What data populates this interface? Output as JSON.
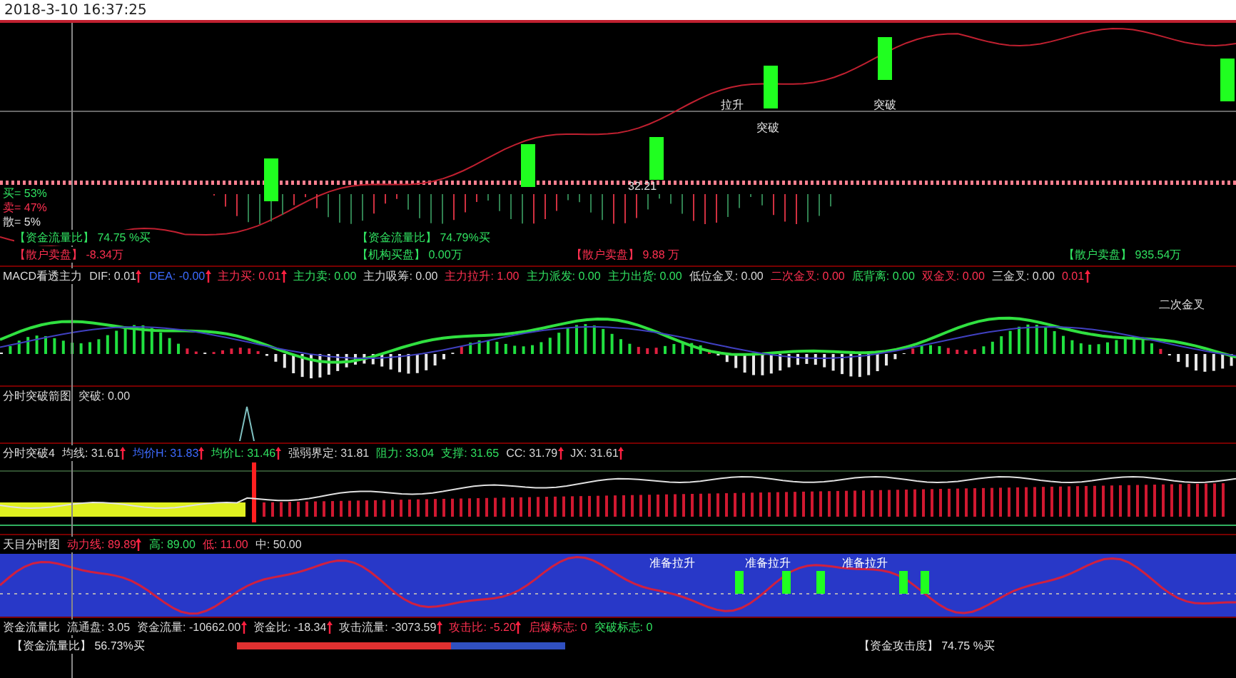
{
  "header": {
    "datetime": "2018-3-10 16:37:25"
  },
  "price_panel": {
    "ratio_labels": [
      {
        "kind": "buy",
        "text": "买= 53%"
      },
      {
        "kind": "sell",
        "text": "卖= 47%"
      },
      {
        "kind": "retail",
        "text": "散= 5%"
      }
    ],
    "tags": [
      {
        "kind": "buy",
        "label": "【资金流量比】",
        "value": "74.75 %买"
      },
      {
        "kind": "sell",
        "label": "【散户卖盘】",
        "value": "-8.34万"
      },
      {
        "kind": "buy",
        "label": "【资金流量比】",
        "value": "74.79%买"
      },
      {
        "kind": "buy",
        "label": "【机构买盘】",
        "value": "0.00万"
      },
      {
        "kind": "sell",
        "label": "【散户卖盘】",
        "value": "9.88 万"
      },
      {
        "kind": "buy",
        "label": "【散户卖盘】",
        "value": "935.54万"
      }
    ],
    "markers": [
      "拉升",
      "突破",
      "32.21",
      "突破"
    ]
  },
  "macd": {
    "title": "MACD看透主力",
    "readings": [
      {
        "kind": "white",
        "label": "DIF:",
        "value": "0.01",
        "rising": true
      },
      {
        "kind": "blue",
        "label": "DEA:",
        "value": "-0.00",
        "rising": true
      },
      {
        "kind": "red",
        "label": "主力买:",
        "value": "0.01",
        "rising": true
      },
      {
        "kind": "green",
        "label": "主力卖:",
        "value": "0.00",
        "rising": false
      },
      {
        "kind": "white",
        "label": "主力吸筹:",
        "value": "0.00",
        "rising": false
      },
      {
        "kind": "red",
        "label": "主力拉升:",
        "value": "1.00",
        "rising": false
      },
      {
        "kind": "green",
        "label": "主力派发:",
        "value": "0.00",
        "rising": false
      },
      {
        "kind": "green",
        "label": "主力出货:",
        "value": "0.00",
        "rising": false
      },
      {
        "kind": "white",
        "label": "低位金叉:",
        "value": "0.00",
        "rising": false
      },
      {
        "kind": "red",
        "label": "二次金叉:",
        "value": "0.00",
        "rising": false
      },
      {
        "kind": "green",
        "label": "底背离:",
        "value": "0.00",
        "rising": false
      },
      {
        "kind": "red",
        "label": "双金叉:",
        "value": "0.00",
        "rising": false
      },
      {
        "kind": "white",
        "label": "三金叉:",
        "value": "0.00",
        "rising": false
      },
      {
        "kind": "red",
        "value": "0.01",
        "rising": true
      }
    ],
    "note": "二次金叉"
  },
  "breakout": {
    "title": "分时突破箭图",
    "readings": [
      {
        "kind": "white",
        "label": "突破:",
        "value": "0.00",
        "rising": false
      }
    ]
  },
  "breakout4": {
    "title": "分时突破4",
    "readings": [
      {
        "kind": "white",
        "label": "均线:",
        "value": "31.61",
        "rising": true
      },
      {
        "kind": "blue",
        "label": "均价H:",
        "value": "31.83",
        "rising": true
      },
      {
        "kind": "green",
        "label": "均价L:",
        "value": "31.46",
        "rising": true
      },
      {
        "kind": "white",
        "label": "强弱界定:",
        "value": "31.81",
        "rising": false
      },
      {
        "kind": "green",
        "label": "阻力:",
        "value": "33.04",
        "rising": false
      },
      {
        "kind": "green",
        "label": "支撑:",
        "value": "31.65",
        "rising": false
      },
      {
        "kind": "white",
        "label": "CC:",
        "value": "31.79",
        "rising": true
      },
      {
        "kind": "white",
        "label": "JX:",
        "value": "31.61",
        "rising": true
      }
    ]
  },
  "tianmu": {
    "title": "天目分时图",
    "readings": [
      {
        "kind": "red",
        "label": "动力线:",
        "value": "89.89",
        "rising": true
      },
      {
        "kind": "green",
        "label": "高:",
        "value": "89.00",
        "rising": false
      },
      {
        "kind": "red",
        "label": "低:",
        "value": "11.00",
        "rising": false
      },
      {
        "kind": "white",
        "label": "中:",
        "value": "50.00",
        "rising": false
      }
    ],
    "signals": [
      "准备拉升",
      "准备拉升",
      "准备拉升"
    ]
  },
  "flow": {
    "title": "资金流量比",
    "readings": [
      {
        "kind": "white",
        "label": "流通盘:",
        "value": "3.05",
        "rising": false
      },
      {
        "kind": "white",
        "label": "资金流量:",
        "value": "-10662.00",
        "rising": true
      },
      {
        "kind": "white",
        "label": "资金比:",
        "value": "-18.34",
        "rising": true
      },
      {
        "kind": "white",
        "label": "攻击流量:",
        "value": "-3073.59",
        "rising": true
      },
      {
        "kind": "red",
        "label": "攻击比:",
        "value": "-5.20",
        "rising": true
      },
      {
        "kind": "red",
        "label": "启爆标志:",
        "value": "0",
        "rising": false
      },
      {
        "kind": "green",
        "label": "突破标志:",
        "value": "0",
        "rising": false
      }
    ],
    "left_label": "【资金流量比】",
    "left_value": "56.73%买",
    "level": 0.65,
    "right_label": "【资金攻击度】",
    "right_value": "74.75 %买"
  }
}
